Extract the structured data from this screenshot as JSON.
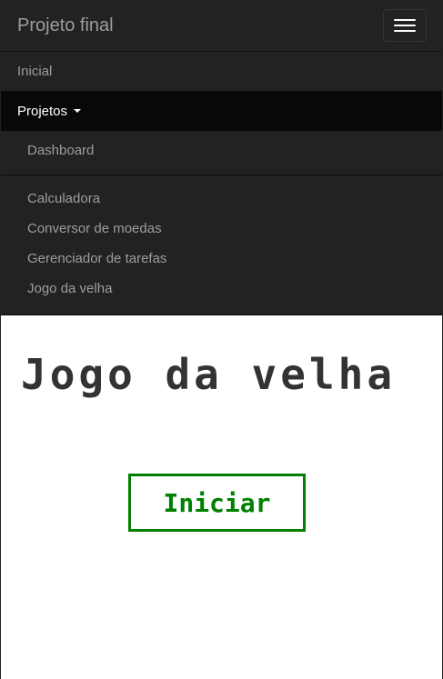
{
  "navbar": {
    "brand": "Projeto final",
    "toggle_icon": "hamburger-icon",
    "items": [
      {
        "label": "Inicial"
      },
      {
        "label": "Projetos"
      }
    ],
    "dropdown": {
      "first": "Dashboard",
      "items": [
        {
          "label": "Calculadora"
        },
        {
          "label": "Conversor de moedas"
        },
        {
          "label": "Gerenciador de tarefas"
        },
        {
          "label": "Jogo da velha"
        }
      ]
    }
  },
  "game": {
    "title": "Jogo da velha",
    "start_label": "Iniciar",
    "accent_color": "#008000"
  }
}
